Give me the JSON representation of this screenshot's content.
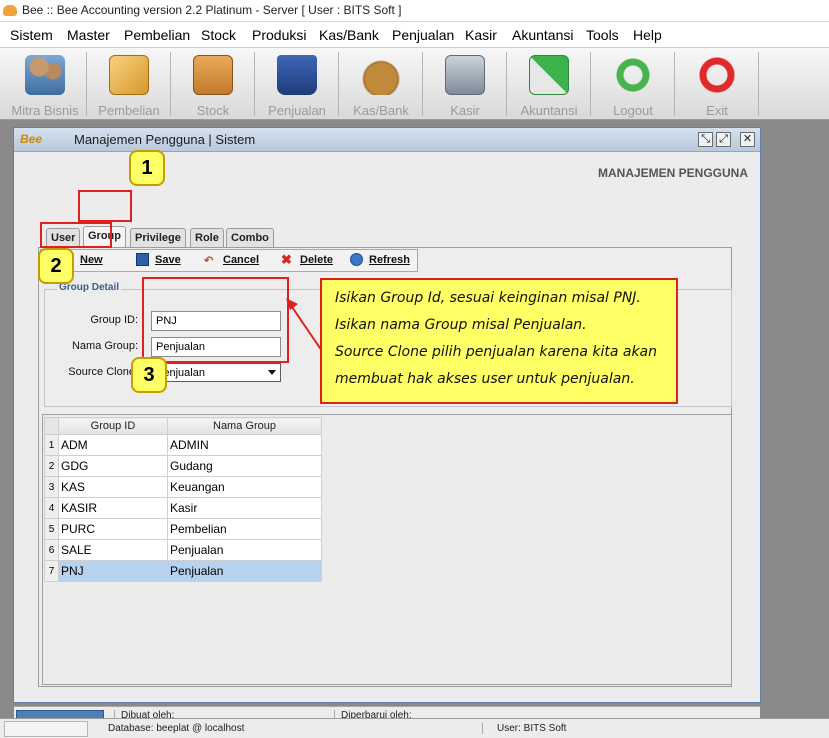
{
  "window": {
    "title": "Bee :: Bee Accounting version 2.2 Platinum - Server  [ User : BITS Soft ]"
  },
  "menu": [
    "Sistem",
    "Master",
    "Pembelian",
    "Stock",
    "Produksi",
    "Kas/Bank",
    "Penjualan",
    "Kasir",
    "Akuntansi",
    "Tools",
    "Help"
  ],
  "toolbar": [
    {
      "label": "Mitra Bisnis",
      "icon": "people-icon"
    },
    {
      "label": "Pembelian",
      "icon": "purchase-icon"
    },
    {
      "label": "Stock",
      "icon": "boxes-icon"
    },
    {
      "label": "Penjualan",
      "icon": "shopping-bag-icon"
    },
    {
      "label": "Kas/Bank",
      "icon": "money-bag-icon"
    },
    {
      "label": "Kasir",
      "icon": "cart-icon"
    },
    {
      "label": "Akuntansi",
      "icon": "chart-up-icon"
    },
    {
      "label": "Logout",
      "icon": "logout-icon"
    },
    {
      "label": "Exit",
      "icon": "power-icon"
    }
  ],
  "frame": {
    "logo": "Bee",
    "title": "Manajemen Pengguna | Sistem",
    "heading": "MANAJEMEN PENGGUNA",
    "tabs": [
      "User",
      "Group",
      "Privilege",
      "Role",
      "Combo"
    ],
    "actions": {
      "new": "New",
      "save": "Save",
      "cancel": "Cancel",
      "delete": "Delete",
      "refresh": "Refresh"
    },
    "detail": {
      "legend": "Group Detail",
      "group_id_label": "Group ID:",
      "group_id_value": "PNJ",
      "nama_group_label": "Nama Group:",
      "nama_group_value": "Penjualan",
      "source_clone_label": "Source Clone:",
      "source_clone_value": "Penjualan"
    },
    "grid": {
      "columns": [
        "Group ID",
        "Nama Group"
      ],
      "rows": [
        {
          "n": "1",
          "id": "ADM",
          "name": "ADMIN"
        },
        {
          "n": "2",
          "id": "GDG",
          "name": "Gudang"
        },
        {
          "n": "3",
          "id": "KAS",
          "name": "Keuangan"
        },
        {
          "n": "4",
          "id": "KASIR",
          "name": "Kasir"
        },
        {
          "n": "5",
          "id": "PURC",
          "name": "Pembelian"
        },
        {
          "n": "6",
          "id": "SALE",
          "name": "Penjualan"
        },
        {
          "n": "7",
          "id": "PNJ",
          "name": "Penjualan"
        }
      ]
    },
    "status": {
      "created": "Dibuat oleh:",
      "updated": "Diperbarui oleh:"
    }
  },
  "statusbar": {
    "database": "Database: beeplat @ localhost",
    "user": "User: BITS Soft"
  },
  "annotations": {
    "steps": [
      "1",
      "2",
      "3"
    ],
    "callout": [
      "Isikan Group Id, sesuai keinginan misal PNJ.",
      "Isikan nama Group misal Penjualan.",
      "Source Clone pilih penjualan karena kita akan",
      "membuat hak akses user untuk penjualan."
    ]
  }
}
